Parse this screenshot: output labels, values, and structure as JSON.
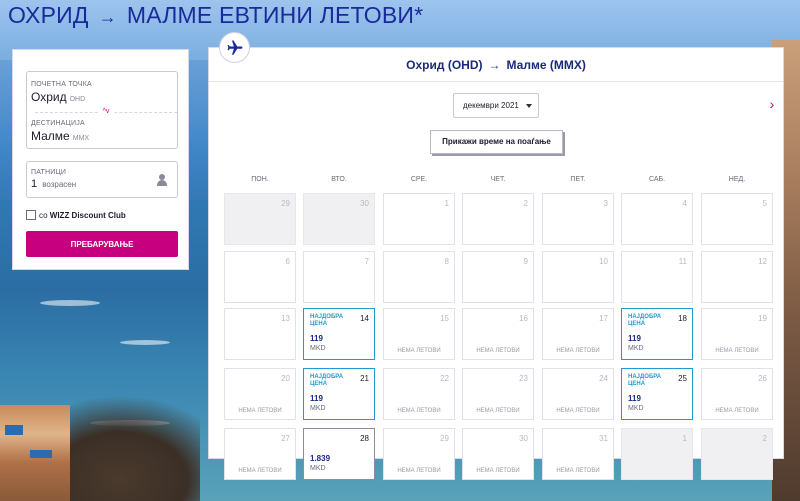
{
  "page": {
    "headline_from": "ОХРИД",
    "headline_arrow": "→",
    "headline_rest": "МАЛМЕ ЕВТИНИ ЛЕТОВИ*"
  },
  "search": {
    "origin_label": "ПОЧЕТНА ТОЧКА",
    "origin_value": "Охрид",
    "origin_code": "OHD",
    "destination_label": "ДЕСТИНАЦИЈА",
    "destination_value": "Малме",
    "destination_code": "MMX",
    "swap_icon": "^v",
    "passengers_label": "ПАТНИЦИ",
    "passengers_count": "1",
    "passengers_type": "возрасен",
    "discount_prefix": "со",
    "discount_name": "WIZZ Discount Club",
    "search_button": "ПРЕБАРУВАЊЕ"
  },
  "results": {
    "route_from": "Охрид (OHD)",
    "route_arrow": "→",
    "route_to": "Малме (MMX)",
    "month": "декември 2021",
    "next_arrow": "›",
    "show_times": "Прикажи време на поаѓање",
    "weekdays": [
      "ПОН.",
      "ВТО.",
      "СРЕ.",
      "ЧЕТ.",
      "ПЕТ.",
      "САБ.",
      "НЕД."
    ],
    "no_flights_label": "НЕМА ЛЕТОВИ",
    "best_price_label": "НАЈДОБРА ЦЕНА",
    "currency": "MKD",
    "days": [
      {
        "day": "29",
        "state": "outside"
      },
      {
        "day": "30",
        "state": "outside"
      },
      {
        "day": "1",
        "state": "past"
      },
      {
        "day": "2",
        "state": "past"
      },
      {
        "day": "3",
        "state": "past"
      },
      {
        "day": "4",
        "state": "past"
      },
      {
        "day": "5",
        "state": "past"
      },
      {
        "day": "6",
        "state": "past"
      },
      {
        "day": "7",
        "state": "past"
      },
      {
        "day": "8",
        "state": "past"
      },
      {
        "day": "9",
        "state": "past"
      },
      {
        "day": "10",
        "state": "past"
      },
      {
        "day": "11",
        "state": "past"
      },
      {
        "day": "12",
        "state": "past"
      },
      {
        "day": "13",
        "state": "past"
      },
      {
        "day": "14",
        "state": "best",
        "price": "119"
      },
      {
        "day": "15",
        "state": "none"
      },
      {
        "day": "16",
        "state": "none"
      },
      {
        "day": "17",
        "state": "none"
      },
      {
        "day": "18",
        "state": "best",
        "price": "119"
      },
      {
        "day": "19",
        "state": "none"
      },
      {
        "day": "20",
        "state": "none"
      },
      {
        "day": "21",
        "state": "best",
        "price": "119"
      },
      {
        "day": "22",
        "state": "none"
      },
      {
        "day": "23",
        "state": "none"
      },
      {
        "day": "24",
        "state": "none"
      },
      {
        "day": "25",
        "state": "best",
        "price": "119"
      },
      {
        "day": "26",
        "state": "none"
      },
      {
        "day": "27",
        "state": "none"
      },
      {
        "day": "28",
        "state": "priced",
        "price": "1.839"
      },
      {
        "day": "29",
        "state": "none"
      },
      {
        "day": "30",
        "state": "none"
      },
      {
        "day": "31",
        "state": "none"
      },
      {
        "day": "1",
        "state": "outside"
      },
      {
        "day": "2",
        "state": "outside"
      }
    ]
  }
}
